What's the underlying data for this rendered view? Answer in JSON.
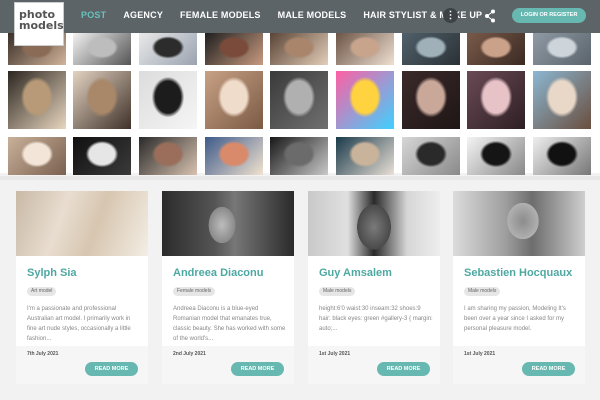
{
  "logo": {
    "line1": "photo",
    "line2": "models"
  },
  "nav": {
    "items": [
      {
        "label": "POST",
        "active": true
      },
      {
        "label": "AGENCY",
        "active": false
      },
      {
        "label": "FEMALE MODELS",
        "active": false
      },
      {
        "label": "MALE MODELS",
        "active": false
      },
      {
        "label": "HAIR STYLIST & MAKE UP",
        "active": false
      }
    ],
    "more_icon": "dots-vertical-icon",
    "share_icon": "share-icon",
    "login_label": "LOGIN OR REGISTER"
  },
  "gallery": {
    "rows": 3,
    "thumbs_per_row": 9
  },
  "colors": {
    "accent": "#67b8b0",
    "header": "#5d6468",
    "name": "#4ea8a2"
  },
  "cards": [
    {
      "name": "Sylph Sia",
      "tag": "Art model",
      "description": "I'm a passionate and professional Australian art model. I primarily work in fine art nude styles, occasionally a little fashion...",
      "date": "7th July 2021",
      "button": "READ MORE"
    },
    {
      "name": "Andreea Diaconu",
      "tag": "Female models",
      "description": "Andreea Diaconu is a blue-eyed Romanian model that emanates true, classic beauty. She has worked with some of the world's...",
      "date": "2nd July 2021",
      "button": "READ MORE"
    },
    {
      "name": "Guy Amsalem",
      "tag": "Male models",
      "description": "height:6'0 waist:30 inseam:32 shoes:9 hair: black eyes: green #gallery-3 { margin: auto;...",
      "date": "1st July 2021",
      "button": "READ MORE"
    },
    {
      "name": "Sebastien Hocquaux",
      "tag": "Male models",
      "description": "I am sharing my passion, Modeling It's been over a year since I asked for my personal pleasure model.",
      "date": "1st July 2021",
      "button": "READ MORE"
    }
  ]
}
